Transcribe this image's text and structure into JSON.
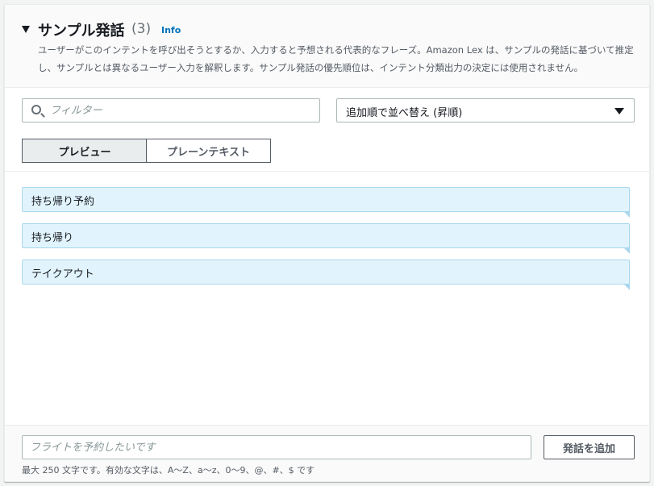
{
  "header": {
    "title": "サンプル発話",
    "count": "(3)",
    "info_link": "Info",
    "description": "ユーザーがこのインテントを呼び出そうとするか、入力すると予想される代表的なフレーズ。Amazon Lex は、サンプルの発話に基づいて推定し、サンプルとは異なるユーザー入力を解釈します。サンプル発話の優先順位は、インテント分類出力の決定には使用されません。"
  },
  "filter": {
    "placeholder": "フィルター",
    "value": ""
  },
  "sort": {
    "selected": "追加順で並べ替え (昇順)"
  },
  "view_toggle": {
    "preview_label": "プレビュー",
    "plaintext_label": "プレーンテキスト",
    "active": "preview"
  },
  "utterances": [
    "持ち帰り予約",
    "持ち帰り",
    "テイクアウト"
  ],
  "footer": {
    "input_placeholder": "フライトを予約したいです",
    "input_value": "",
    "add_button": "発話を追加",
    "constraint_text": "最大 250 文字です。有効な文字は、A〜Z、a〜z、0〜9、@、#、$ です"
  },
  "colors": {
    "link": "#0073bb",
    "utterance_bg": "#e1f4fd",
    "utterance_border": "#a8d7ee"
  }
}
